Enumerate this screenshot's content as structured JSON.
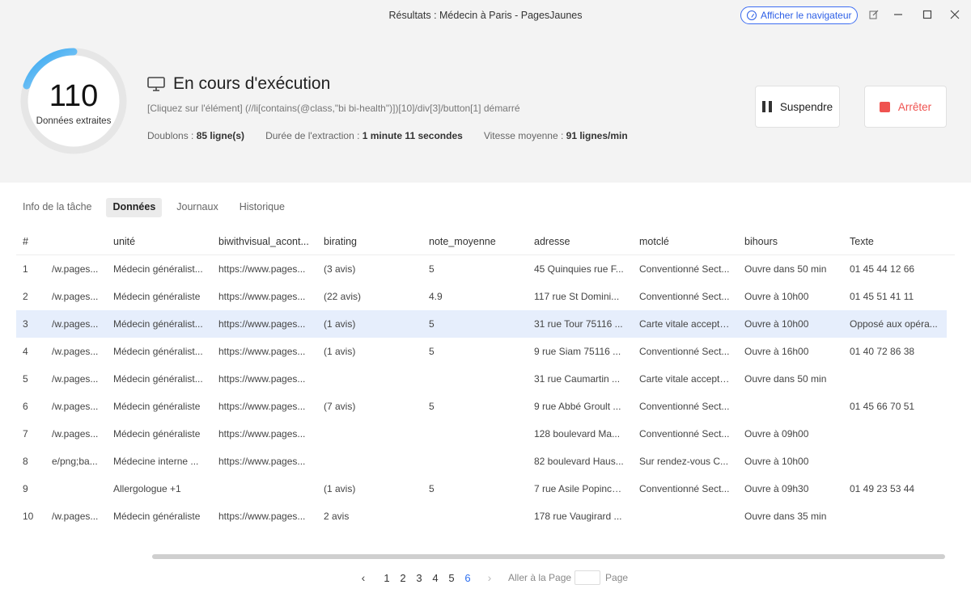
{
  "window": {
    "title": "Résultats : Médecin à Paris - PagesJaunes",
    "show_browser_label": "Afficher le navigateur"
  },
  "progress": {
    "count": "110",
    "count_label": "Données extraites",
    "status_title": "En cours d'exécution",
    "current_action": "[Cliquez sur l'élément] (//li[contains(@class,\"bi bi-health\")])[10]/div[3]/button[1] démarré",
    "duplicates_label": "Doublons : ",
    "duplicates_value": "85 ligne(s)",
    "duration_label": "Durée de l'extraction : ",
    "duration_value": "1 minute 11 secondes",
    "speed_label": "Vitesse moyenne : ",
    "speed_value": "91 lignes/min",
    "accent_color": "#3aaaf0"
  },
  "buttons": {
    "pause": "Suspendre",
    "stop": "Arrêter"
  },
  "tabs": [
    {
      "label": "Info de la tâche"
    },
    {
      "label": "Données"
    },
    {
      "label": "Journaux"
    },
    {
      "label": "Historique"
    }
  ],
  "table": {
    "columns": [
      "#",
      "",
      "unité",
      "biwithvisual_acont...",
      "birating",
      "note_moyenne",
      "adresse",
      "motclé",
      "bihours",
      "Texte"
    ],
    "rows": [
      [
        "1",
        "/w.pages...",
        "Médecin généralist...",
        "https://www.pages...",
        "(3 avis)",
        "5",
        "45 Quinquies rue F...",
        "Conventionné Sect...",
        "Ouvre dans 50 min",
        "01 45 44 12 66"
      ],
      [
        "2",
        "/w.pages...",
        "Médecin généraliste",
        "https://www.pages...",
        "(22 avis)",
        "4.9",
        "117 rue St Domini...",
        "Conventionné Sect...",
        "Ouvre à 10h00",
        "01 45 51 41 11"
      ],
      [
        "3",
        "/w.pages...",
        "Médecin généralist...",
        "https://www.pages...",
        "(1 avis)",
        "5",
        "31 rue Tour 75116 ...",
        "Carte vitale acceptée",
        "Ouvre à 10h00",
        "Opposé aux opéra..."
      ],
      [
        "4",
        "/w.pages...",
        "Médecin généralist...",
        "https://www.pages...",
        "(1 avis)",
        "5",
        "9 rue Siam 75116 ...",
        "Conventionné Sect...",
        "Ouvre à 16h00",
        "01 40 72 86 38"
      ],
      [
        "5",
        "/w.pages...",
        "Médecin généralist...",
        "https://www.pages...",
        "",
        "",
        "31 rue Caumartin ...",
        "Carte vitale acceptée",
        "Ouvre dans 50 min",
        ""
      ],
      [
        "6",
        "/w.pages...",
        "Médecin généraliste",
        "https://www.pages...",
        "(7 avis)",
        "5",
        "9 rue Abbé Groult ...",
        "Conventionné Sect...",
        "",
        "01 45 66 70 51"
      ],
      [
        "7",
        "/w.pages...",
        "Médecin généraliste",
        "https://www.pages...",
        "",
        "",
        "128 boulevard Ma...",
        "Conventionné Sect...",
        "Ouvre à 09h00",
        ""
      ],
      [
        "8",
        "e/png;ba...",
        "Médecine interne ...",
        "https://www.pages...",
        "",
        "",
        "82 boulevard Haus...",
        "Sur rendez-vous C...",
        "Ouvre à 10h00",
        ""
      ],
      [
        "9",
        "",
        "Allergologue +1",
        "",
        "(1 avis)",
        "5",
        "7 rue Asile Popinco...",
        "Conventionné Sect...",
        "Ouvre à 09h30",
        "01 49 23 53 44"
      ],
      [
        "10",
        "/w.pages...",
        "Médecin généraliste",
        "https://www.pages...",
        "2 avis",
        "",
        "178 rue Vaugirard ...",
        "",
        "Ouvre dans 35 min",
        ""
      ]
    ]
  },
  "pagination": {
    "pages": [
      "1",
      "2",
      "3",
      "4",
      "5",
      "6"
    ],
    "current_page": "6",
    "goto_label": "Aller à la Page",
    "page_suffix": "Page"
  }
}
